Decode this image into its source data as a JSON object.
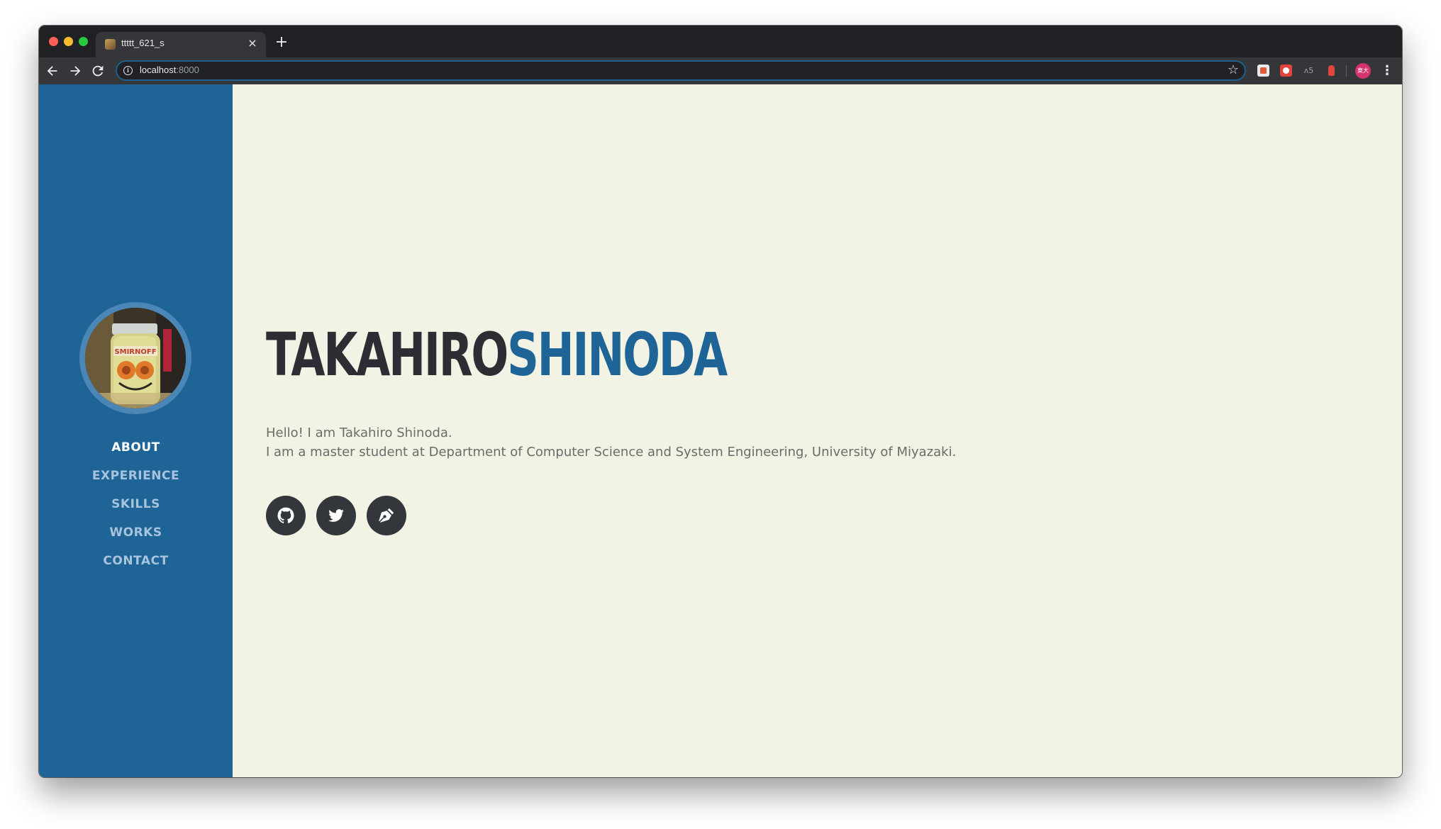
{
  "browser": {
    "tab_title": "ttttt_621_s",
    "tab_close": "×",
    "new_tab": "+",
    "url_host": "localhost",
    "url_port": ":8000",
    "avatar_text": "東大"
  },
  "sidebar": {
    "nav": [
      {
        "label": "ABOUT",
        "active": true
      },
      {
        "label": "EXPERIENCE",
        "active": false
      },
      {
        "label": "SKILLS",
        "active": false
      },
      {
        "label": "WORKS",
        "active": false
      },
      {
        "label": "CONTACT",
        "active": false
      }
    ],
    "profile_label": "SMIRNOFF"
  },
  "main": {
    "first_name": "TAKAHIRO",
    "last_name": "SHINODA",
    "intro_line1": "Hello! I am Takahiro Shinoda.",
    "intro_line2": "I am a master student at Department of Computer Science and System Engineering, University of Miyazaki.",
    "socials": [
      {
        "icon": "github-icon"
      },
      {
        "icon": "twitter-icon"
      },
      {
        "icon": "pen-icon"
      }
    ]
  },
  "colors": {
    "sidebar": "#1f6496",
    "accent": "#1f6496",
    "dark": "#2d2e33",
    "background": "#f3f3e5"
  }
}
